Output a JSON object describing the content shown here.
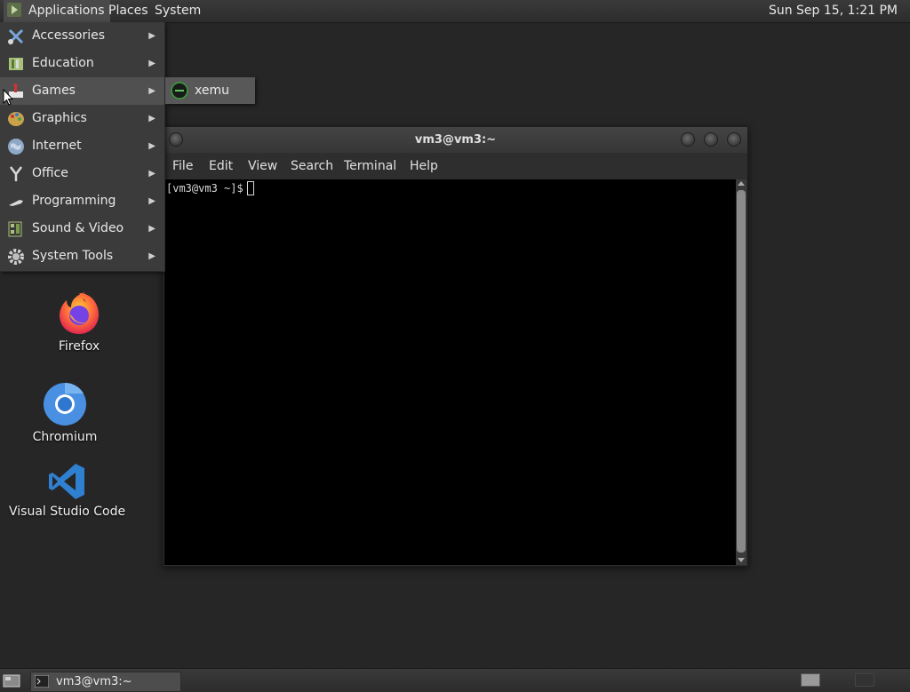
{
  "top_panel": {
    "applications_label": "Applications",
    "places_label": "Places",
    "system_label": "System",
    "clock": "Sun Sep 15,  1:21 PM"
  },
  "applications_menu": {
    "items": [
      {
        "label": "Accessories",
        "icon": "accessories-icon"
      },
      {
        "label": "Education",
        "icon": "education-icon"
      },
      {
        "label": "Games",
        "icon": "games-icon",
        "active": true
      },
      {
        "label": "Graphics",
        "icon": "graphics-icon"
      },
      {
        "label": "Internet",
        "icon": "internet-icon"
      },
      {
        "label": "Office",
        "icon": "office-icon"
      },
      {
        "label": "Programming",
        "icon": "programming-icon"
      },
      {
        "label": "Sound & Video",
        "icon": "sound-video-icon"
      },
      {
        "label": "System Tools",
        "icon": "system-tools-icon"
      }
    ],
    "arrow": "▶"
  },
  "games_submenu": {
    "items": [
      {
        "label": "xemu",
        "icon": "xemu-icon"
      }
    ]
  },
  "desktop_icons": {
    "firefox": "Firefox",
    "chromium": "Chromium",
    "vscode": "Visual Studio Code"
  },
  "terminal": {
    "title": "vm3@vm3:~",
    "menu": {
      "file": "File",
      "edit": "Edit",
      "view": "View",
      "search": "Search",
      "terminal": "Terminal",
      "help": "Help"
    },
    "prompt": "[vm3@vm3 ~]$"
  },
  "bottom_panel": {
    "task_label": "vm3@vm3:~"
  },
  "colors": {
    "desktop_bg": "#262626",
    "panel_bg": "#333333",
    "menu_bg": "#3b3b3b",
    "terminal_bg": "#000000",
    "firefox_orange": "#ff7139",
    "chromium_blue": "#4a90e2",
    "vscode_blue": "#2f80d1"
  }
}
